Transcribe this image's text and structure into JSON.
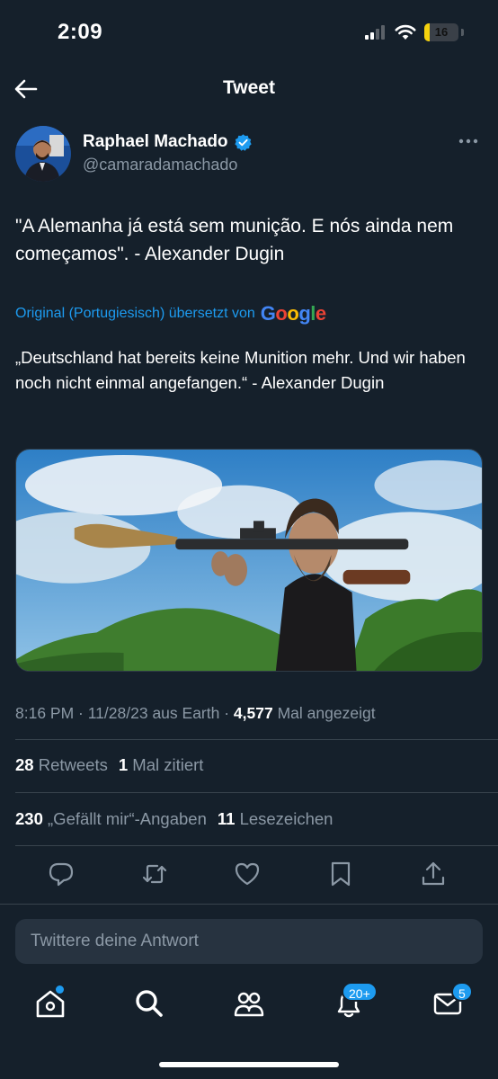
{
  "status_bar": {
    "time": "2:09",
    "battery": "16",
    "battery_level": 0.16
  },
  "header": {
    "title": "Tweet"
  },
  "author": {
    "name": "Raphael Machado",
    "handle": "@camaradamachado"
  },
  "tweet": {
    "text": "\"A Alemanha já está sem munição. E nós ainda nem começamos\". - Alexander Dugin",
    "translation_note": "Original (Portugiesisch) übersetzt von",
    "translation_brand": "Google",
    "translated_text": "„Deutschland hat bereits keine Munition mehr. Und wir haben noch nicht einmal angefangen.“ - Alexander Dugin"
  },
  "meta": {
    "time": "8:16 PM",
    "date": "11/28/23",
    "source": "aus Earth",
    "views": "4,577",
    "views_label": "Mal angezeigt"
  },
  "stats": {
    "retweets": "28",
    "retweets_label": "Retweets",
    "quotes": "1",
    "quotes_label": "Mal zitiert",
    "likes": "230",
    "likes_label": "„Gefällt mir“-Angaben",
    "bookmarks": "11",
    "bookmarks_label": "Lesezeichen"
  },
  "reply": {
    "placeholder": "Twittere deine Antwort"
  },
  "tabbar": {
    "notifications_badge": "20+",
    "messages_badge": "5"
  },
  "colors": {
    "background": "#15202b",
    "accent": "#1d9bf0",
    "secondary_text": "#8b98a5",
    "divider": "#38444d"
  },
  "icons": [
    "back-arrow-icon",
    "verified-badge-icon",
    "more-icon",
    "reply-icon",
    "retweet-icon",
    "like-icon",
    "bookmark-icon",
    "share-icon",
    "home-icon",
    "search-icon",
    "communities-icon",
    "notifications-icon",
    "messages-icon"
  ]
}
